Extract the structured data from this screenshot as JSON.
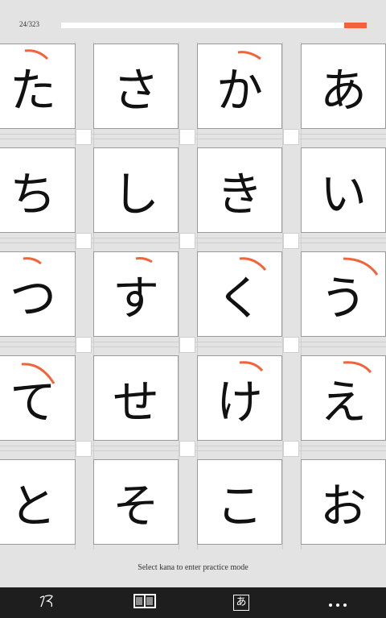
{
  "progress": {
    "label": "24/323",
    "fraction": 0.074
  },
  "accent_color": "#f4623a",
  "instruction": "Select kana to enter practice mode",
  "tiles": [
    [
      "た",
      "さ",
      "か",
      "あ"
    ],
    [
      "ち",
      "し",
      "き",
      "い"
    ],
    [
      "つ",
      "す",
      "く",
      "う"
    ],
    [
      "て",
      "せ",
      "け",
      "え"
    ],
    [
      "と",
      "そ",
      "こ",
      "お"
    ]
  ],
  "nav": {
    "items": [
      {
        "icon": "brush-stroke-icon"
      },
      {
        "icon": "book-icon"
      },
      {
        "icon": "kana-a-icon",
        "glyph": "あ"
      },
      {
        "icon": "more-icon"
      }
    ]
  }
}
